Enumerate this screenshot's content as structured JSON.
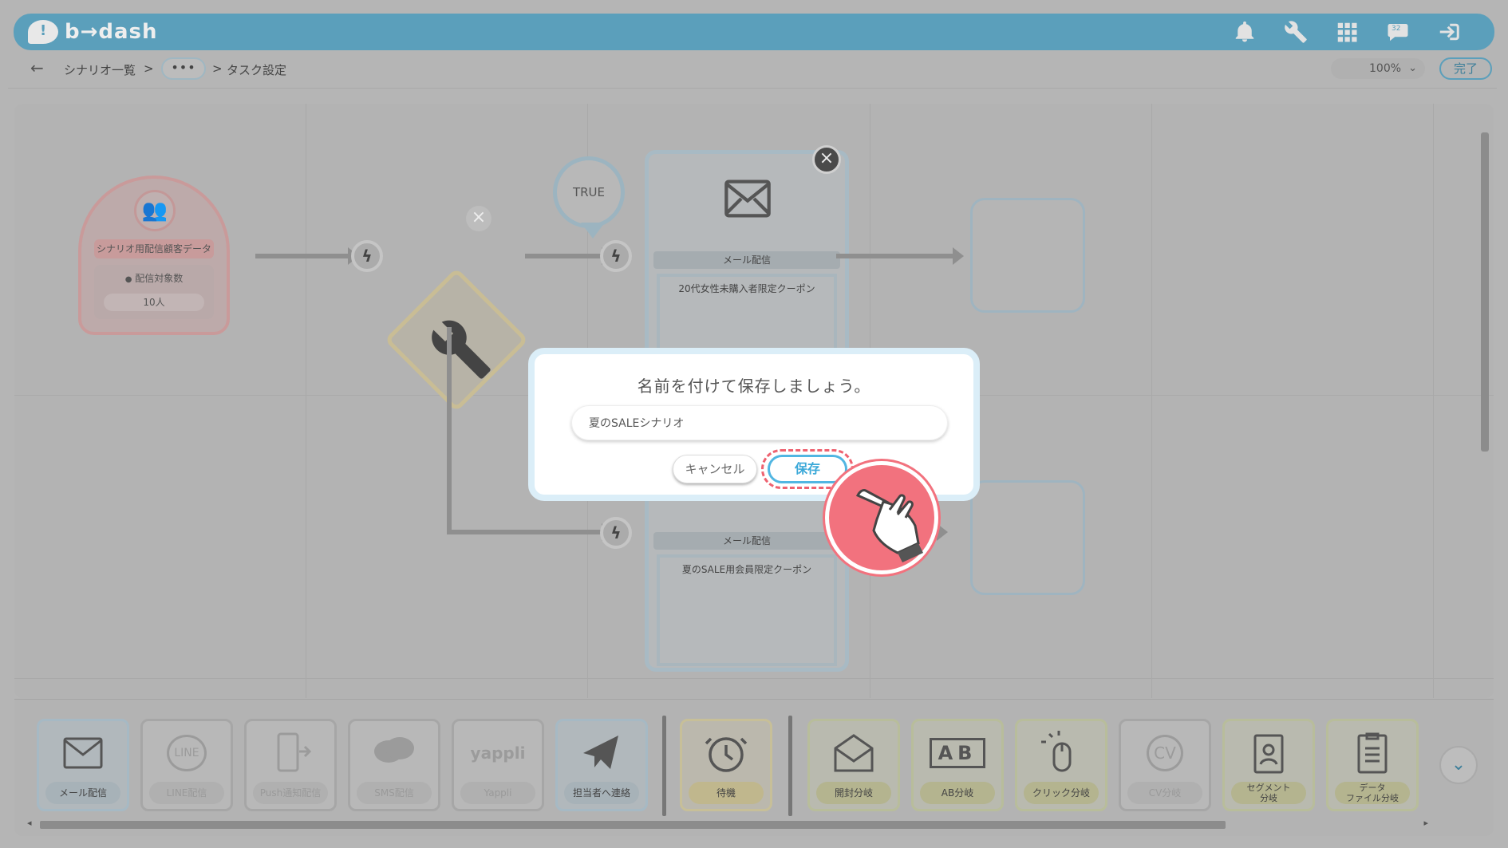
{
  "app": {
    "logo_text": "b→dash",
    "logo_mark": "!"
  },
  "header": {
    "icons": [
      "bell-icon",
      "wrench-icon",
      "grid-icon",
      "chat-icon",
      "logout-icon"
    ],
    "chat_badge": "32"
  },
  "breadcrumb": {
    "back": "←",
    "root": "シナリオ一覧",
    "sep1": ">",
    "ellipsis": "•••",
    "sep2": ">",
    "current": "タスク設定"
  },
  "toolbar": {
    "zoom": "100%",
    "zoom_chevron": "⌄",
    "done_label": "完了"
  },
  "canvas": {
    "segment": {
      "title": "シナリオ用配信顧客データ",
      "count_label": "配信対象数",
      "count_value": "10人"
    },
    "true_label": "TRUE",
    "mail_card_top": {
      "label": "メール配信",
      "body": "20代女性未購入者限定クーポン"
    },
    "mail_card_bottom": {
      "label": "メール配信",
      "body": "夏のSALE用会員限定クーポン"
    }
  },
  "palette": {
    "items": [
      {
        "label": "メール配信",
        "icon": "mail-icon"
      },
      {
        "label": "LINE配信",
        "icon": "line-icon"
      },
      {
        "label": "Push通知配信",
        "icon": "push-icon"
      },
      {
        "label": "SMS配信",
        "icon": "sms-icon"
      },
      {
        "label": "Yappli",
        "icon": "yappli-icon",
        "icon_text": "yappli"
      },
      {
        "label": "担当者へ連絡",
        "icon": "paper-plane-icon"
      },
      {
        "label": "待機",
        "icon": "alarm-clock-icon"
      },
      {
        "label": "開封分岐",
        "icon": "open-mail-icon"
      },
      {
        "label": "AB分岐",
        "icon": "ab-icon",
        "icon_text": "AB"
      },
      {
        "label": "クリック分岐",
        "icon": "mouse-click-icon"
      },
      {
        "label": "CV分岐",
        "icon": "cv-icon",
        "icon_text": "CV"
      },
      {
        "label": "セグメント\n分岐",
        "icon": "badge-icon"
      },
      {
        "label": "データ\nファイル分岐",
        "icon": "clipboard-icon"
      }
    ],
    "line_icon_text": "LINE"
  },
  "modal": {
    "title": "名前を付けて保存しましょう。",
    "input_value": "夏のSALEシナリオ",
    "cancel_label": "キャンセル",
    "save_label": "保存"
  },
  "colors": {
    "header": "#5b9fbb",
    "accent": "#51b6e2",
    "highlight": "#ee6270",
    "overlay": "#b5b5b5"
  }
}
